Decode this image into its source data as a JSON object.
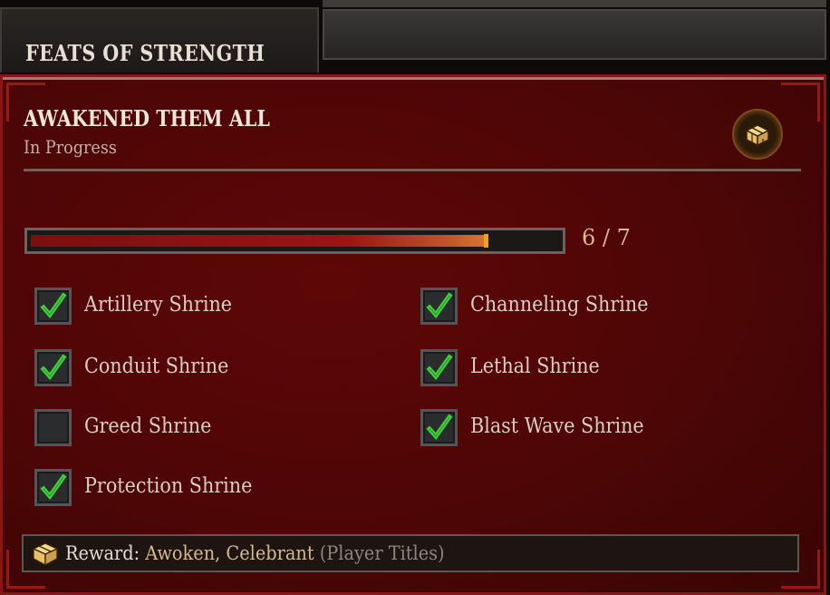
{
  "tab": {
    "label": "FEATS OF STRENGTH"
  },
  "achievement": {
    "title": "AWAKENED THEM ALL",
    "status": "In Progress"
  },
  "progress": {
    "current": 6,
    "total": 7,
    "text": "6 / 7"
  },
  "objectives": [
    {
      "label": "Artillery Shrine",
      "checked": true
    },
    {
      "label": "Channeling Shrine",
      "checked": true
    },
    {
      "label": "Conduit Shrine",
      "checked": true
    },
    {
      "label": "Lethal Shrine",
      "checked": true
    },
    {
      "label": "Greed Shrine",
      "checked": false
    },
    {
      "label": "Blast Wave Shrine",
      "checked": true
    },
    {
      "label": "Protection Shrine",
      "checked": true
    }
  ],
  "reward": {
    "label": "Reward:",
    "value": "Awoken, Celebrant",
    "type": "(Player Titles)",
    "icon": "chest-icon"
  },
  "colors": {
    "panel_bg": "#4d0606",
    "check": "#3fd13c",
    "gold_text": "#d7b98b",
    "progress_tip": "#f2a024"
  }
}
